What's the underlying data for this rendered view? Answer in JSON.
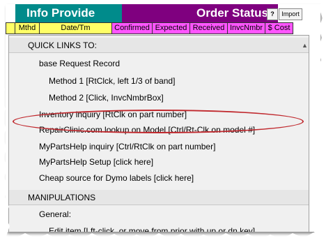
{
  "header": {
    "info_title": "Info Provide",
    "order_title": "Order Status",
    "help_button": "?",
    "import_button": "Import",
    "columns": [
      "Mthd",
      "Date/Tm",
      "Confirmed",
      "Expected",
      "Received",
      "InvcNmbr",
      "$ Cost"
    ]
  },
  "menu": {
    "quick_links_heading": "QUICK LINKS TO:",
    "items": [
      "base Request Record",
      "Method 1  [RtClck, left 1/3 of band]",
      "Method 2  [Click, InvcNmbrBox]",
      "Inventory inquiry  [RtClk on part number]",
      "RepairClinic.com lookup on Model [Ctrl/Rt-Clk on model #]",
      "MyPartsHelp inquiry  [Ctrl/RtClk on part number]",
      "MyPartsHelp Setup  [click here]",
      "Cheap source for Dymo labels [click here]"
    ],
    "manipulations_heading": "MANIPULATIONS",
    "general_label": "General:",
    "partial_item": "Edit item [Lft-click, or move from prior with up or dn key]"
  },
  "colors": {
    "teal": "#008b8b",
    "purple": "#7f007f",
    "yellow": "#ffff66",
    "pink": "#ff55ff",
    "highlight": "#c0282d"
  }
}
